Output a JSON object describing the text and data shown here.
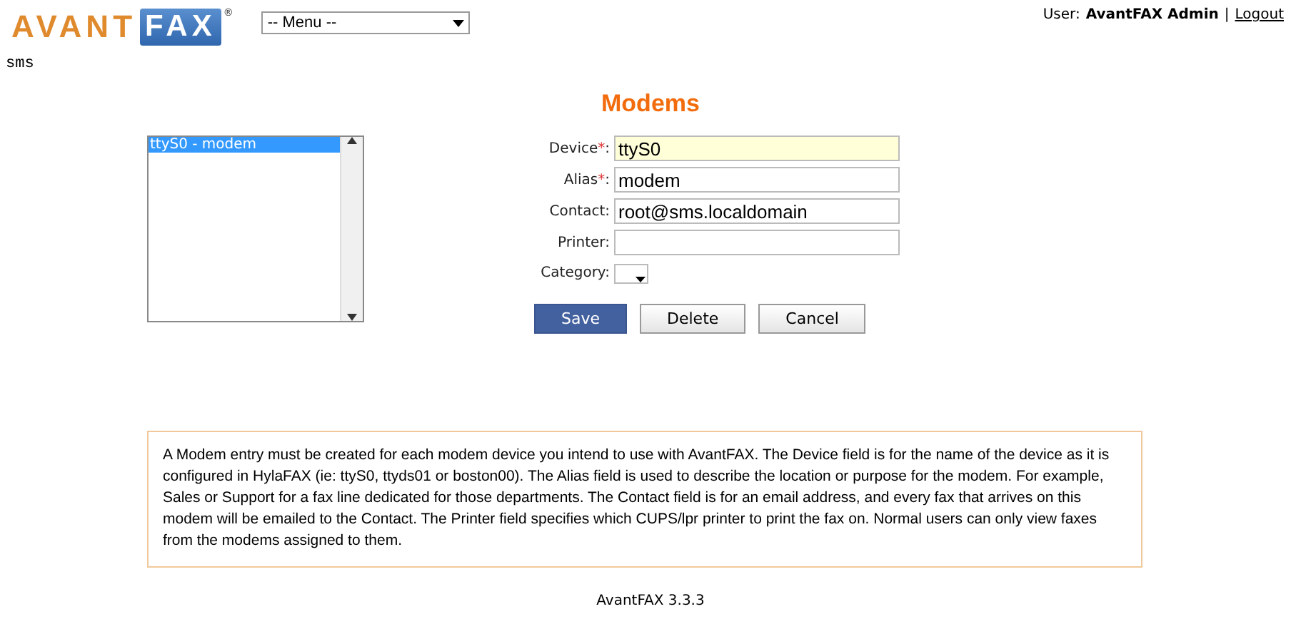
{
  "logo": {
    "part_1": "AVANT",
    "part_2": "FAX",
    "mark": "®"
  },
  "menu": {
    "value": "-- Menu --"
  },
  "user": {
    "label": "User:",
    "name": "AvantFAX Admin",
    "separator": "|",
    "logout": "Logout"
  },
  "host": "sms",
  "title": "Modems",
  "modem_list": [
    {
      "label": "ttyS0 - modem",
      "selected": true
    }
  ],
  "fields": [
    {
      "label": "Device",
      "required_mark": "*",
      "colon": ":",
      "value": "ttyS0",
      "focused": true
    },
    {
      "label": "Alias",
      "required_mark": "*",
      "colon": ":",
      "value": "modem",
      "focused": false
    },
    {
      "label": "Contact",
      "colon": ":",
      "value": "root@sms.localdomain",
      "focused": false
    },
    {
      "label": "Printer",
      "colon": ":",
      "focused": false
    }
  ],
  "category": {
    "label": "Category:"
  },
  "buttons": [
    {
      "label": "Save",
      "primary": true
    },
    {
      "label": "Delete",
      "primary": false
    },
    {
      "label": "Cancel",
      "primary": false
    }
  ],
  "help": "A Modem entry must be created for each modem device you intend to use with AvantFAX. The Device field is for the name of the device as it is configured in HylaFAX (ie: ttyS0, ttyds01 or boston00). The Alias field is used to describe the location or purpose for the modem. For example, Sales or Support for a fax line dedicated for those departments. The Contact field is for an email address, and every fax that arrives on this modem will be emailed to the Contact. The Printer field specifies which CUPS/lpr printer to print the fax on. Normal users can only view faxes from the modems assigned to them.",
  "footer": "AvantFAX 3.3.3"
}
